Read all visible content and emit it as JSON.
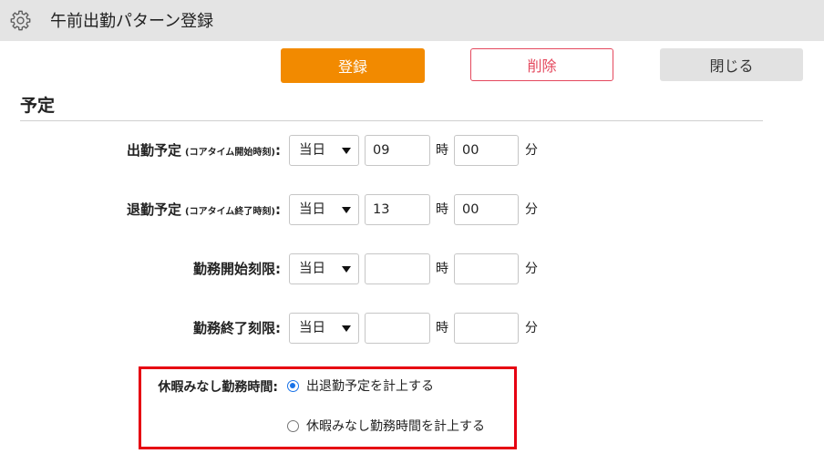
{
  "header": {
    "title": "午前出勤パターン登録",
    "icon": "gear-icon"
  },
  "actions": {
    "register": "登録",
    "delete": "削除",
    "close": "閉じる"
  },
  "section": {
    "title": "予定"
  },
  "units": {
    "hour": "時",
    "minute": "分"
  },
  "rows": [
    {
      "label": "出勤予定",
      "note": "(コアタイム開始時刻)",
      "colon": ":",
      "day": "当日",
      "hour": "09",
      "minute": "00"
    },
    {
      "label": "退勤予定",
      "note": "(コアタイム終了時刻)",
      "colon": ":",
      "day": "当日",
      "hour": "13",
      "minute": "00"
    },
    {
      "label": "勤務開始刻限",
      "colon": ":",
      "day": "当日",
      "hour": "",
      "minute": ""
    },
    {
      "label": "勤務終了刻限",
      "colon": ":",
      "day": "当日",
      "hour": "",
      "minute": ""
    }
  ],
  "holiday": {
    "label": "休暇みなし勤務時間",
    "colon": ":",
    "options": [
      {
        "label": "出退勤予定を計上する",
        "checked": true
      },
      {
        "label": "休暇みなし勤務時間を計上する",
        "checked": false
      }
    ]
  },
  "colors": {
    "accent": "#f28a00",
    "danger": "#e4485d",
    "highlight": "#e60012",
    "radio": "#1a73e8",
    "titlebar": "#e4e4e4"
  }
}
